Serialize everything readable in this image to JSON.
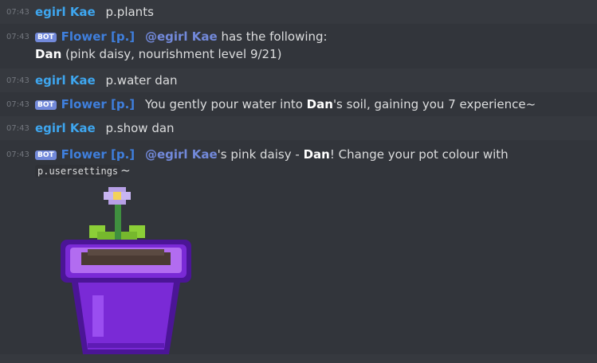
{
  "messages": [
    {
      "time": "07:43",
      "author": "egirl Kae",
      "text": "p.plants"
    },
    {
      "time": "07:43",
      "bot_tag": "BOT",
      "author": "Flower [p.]",
      "mention": "@egirl Kae",
      "text": "has the following:",
      "line2_bold": "Dan",
      "line2_rest": "(pink daisy, nourishment level 9/21)"
    },
    {
      "time": "07:43",
      "author": "egirl Kae",
      "text": "p.water dan"
    },
    {
      "time": "07:43",
      "bot_tag": "BOT",
      "author": "Flower [p.]",
      "text_a": "You gently pour water into ",
      "bold": "Dan",
      "text_b": "'s soil, gaining you 7 experience~"
    },
    {
      "time": "07:43",
      "author": "egirl Kae",
      "text": "p.show dan"
    },
    {
      "time": "07:43",
      "bot_tag": "BOT",
      "author": "Flower [p.]",
      "mention": "@egirl Kae",
      "text_a": "'s pink daisy - ",
      "bold": "Dan",
      "text_b": "! Change your pot colour with ",
      "code": "p.usersettings",
      "text_c": "~"
    }
  ],
  "colors": {
    "bg": "#36393f",
    "pot": "#7a2ad6",
    "pot_dark": "#4b1596",
    "pot_light": "#b26cf0",
    "soil": "#4a3a33",
    "leaf": "#8ccf37",
    "stem": "#3f8f3f",
    "flower": "#b7a0e6"
  }
}
